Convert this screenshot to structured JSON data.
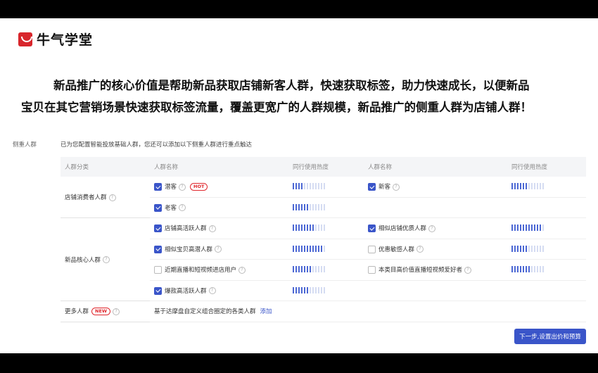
{
  "logo": {
    "text": "牛气学堂",
    "icon": "horns-logo-icon",
    "color": "#d8262c"
  },
  "headline": {
    "line1": "新品推广的核心价值是帮助新品获取店铺新客人群，快速获取标签，助力快速成长，以便新品",
    "line2": "宝贝在其它营销场景快速获取标签流量，覆盖更宽广的人群规模，新品推广的侧重人群为店铺人群！"
  },
  "section": {
    "label": "侧重人群",
    "description": "已为您配置智能投放基础人群，您还可以添加以下侧重人群进行重点触达"
  },
  "table": {
    "headers": {
      "category": "人群分类",
      "name1": "人群名称",
      "heat1": "同行使用热度",
      "name2": "人群名称",
      "heat2": "同行使用热度"
    },
    "groups": {
      "store": "店铺消费者人群",
      "core": "新品核心人群",
      "more": "更多人群"
    },
    "more_tag": "NEW",
    "hot_tag": "HOT",
    "more_text": "基于达摩盘自定义组合圈定的各类人群",
    "more_link": "添加",
    "rows": [
      {
        "left": {
          "label": "潜客",
          "checked": true,
          "heat": 4
        },
        "right": {
          "label": "新客",
          "checked": true,
          "heat": 6
        }
      },
      {
        "left": {
          "label": "老客",
          "checked": true,
          "heat": 6
        }
      },
      {
        "left": {
          "label": "店铺高活跃人群",
          "checked": true,
          "heat": 8
        },
        "right": {
          "label": "相似店铺优质人群",
          "checked": true,
          "heat": 11
        }
      },
      {
        "left": {
          "label": "相似宝贝高潜人群",
          "checked": true,
          "heat": 11
        },
        "right": {
          "label": "优惠敏感人群",
          "checked": false,
          "heat": 6
        }
      },
      {
        "left": {
          "label": "近期直播和短视频进店用户",
          "checked": false,
          "heat": 7
        },
        "right": {
          "label": "本类目高价值直播短视频爱好者",
          "checked": false,
          "heat": 7
        }
      },
      {
        "left": {
          "label": "爆款高活跃人群",
          "checked": true,
          "heat": 6
        }
      }
    ]
  },
  "next_button": "下一步,设置出价和预算",
  "accent_color": "#3a55c9"
}
